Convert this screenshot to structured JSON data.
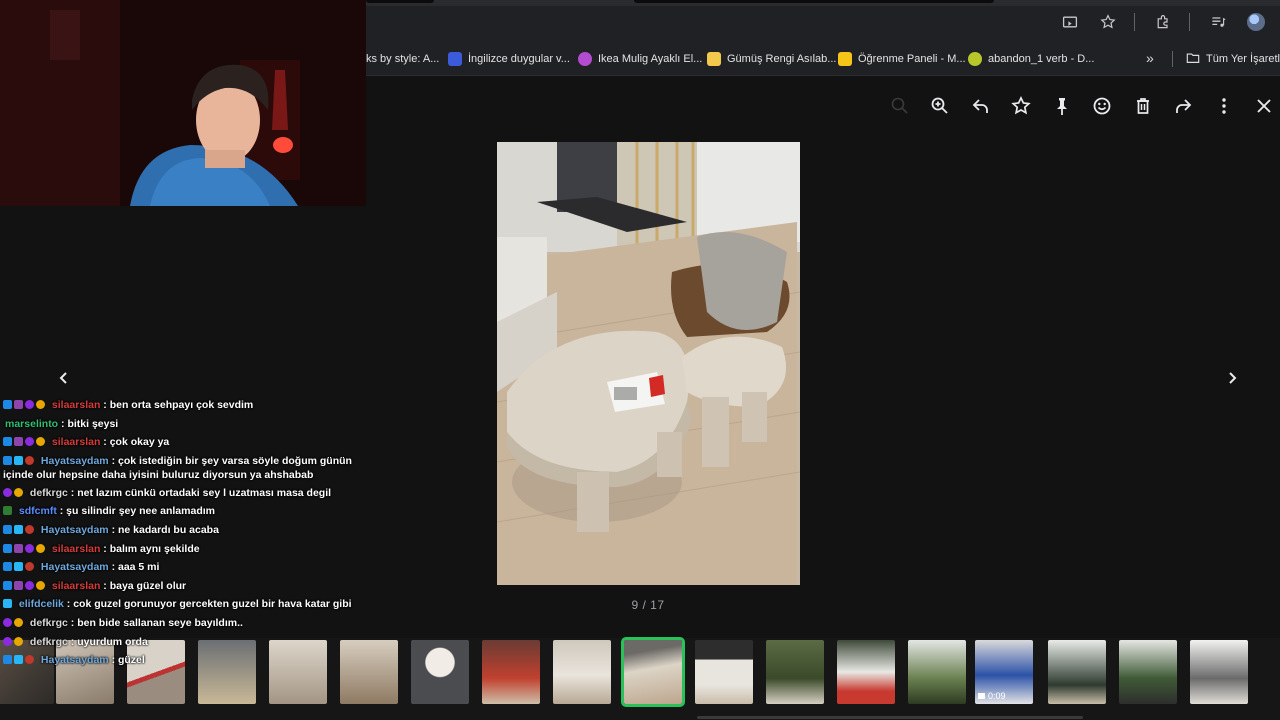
{
  "browser": {
    "toolbar_icons": [
      "cast-icon",
      "star-icon",
      "extension-icon",
      "media-icon",
      "profile-avatar"
    ],
    "bookmarks": [
      {
        "label": "ks by style: A...",
        "icon": "bookmark-favicon",
        "color": "#ffffff"
      },
      {
        "label": "İngilizce duygular v...",
        "icon": "bookmark-favicon",
        "color": "#3b5bdb"
      },
      {
        "label": "Ikea Mulig Ayaklı El...",
        "icon": "bookmark-favicon",
        "color": "#b44cd1"
      },
      {
        "label": "Gümüş Rengi Asılab...",
        "icon": "bookmark-favicon",
        "color": "#f2c94c"
      },
      {
        "label": "Öğrenme Paneli - M...",
        "icon": "bookmark-favicon",
        "color": "#f5c518"
      },
      {
        "label": "abandon_1 verb - D...",
        "icon": "bookmark-favicon",
        "color": "#b7c72a"
      }
    ],
    "bookmarks_more": "»",
    "all_bookmarks": "Tüm Yer İşaretleri"
  },
  "viewer": {
    "counter": "9 / 17",
    "tools": [
      "zoom-out-icon",
      "zoom-in-icon",
      "reply-icon",
      "star-icon",
      "pin-icon",
      "emoji-icon",
      "delete-icon",
      "forward-icon",
      "more-icon",
      "close-icon"
    ],
    "selected_index": 9,
    "video_duration": "0:09"
  },
  "chat": {
    "messages": [
      {
        "user": "silaarslan",
        "text": ": ben orta sehpayı çok sevdim",
        "color": "#d63b3b"
      },
      {
        "user": "marselinto",
        "text": ": bitki şeysi",
        "color": "#2fbf71"
      },
      {
        "user": "silaarslan",
        "text": ": çok okay ya",
        "color": "#d63b3b"
      },
      {
        "user": "Hayatsaydam",
        "text": ": çok istediğin bir şey varsa söyle doğum günün içinde olur hepsine daha iyisini buluruz diyorsun ya ahshabab",
        "color": "#6fa8dc"
      },
      {
        "user": "defkrgc",
        "text": ": net lazım cünkü ortadaki sey l uzatması masa degil",
        "color": "#d9d9d9"
      },
      {
        "user": "sdfcmft",
        "text": ": şu silindir şey nee anlamadım",
        "color": "#5b8cff"
      },
      {
        "user": "Hayatsaydam",
        "text": ": ne kadardı bu acaba",
        "color": "#6fa8dc"
      },
      {
        "user": "silaarslan",
        "text": ": balım aynı şekilde",
        "color": "#d63b3b"
      },
      {
        "user": "Hayatsaydam",
        "text": ": aaa 5 mi",
        "color": "#6fa8dc"
      },
      {
        "user": "silaarslan",
        "text": ": baya güzel olur",
        "color": "#d63b3b"
      },
      {
        "user": "elifdcelik",
        "text": ": cok guzel gorunuyor gercekten guzel bir hava katar gibi",
        "color": "#6fa8dc"
      },
      {
        "user": "defkrgc",
        "text": ": ben bide sallanan seye bayıldım..",
        "color": "#d9d9d9"
      },
      {
        "user": "defkrgc",
        "text": ": uyurdum orda",
        "color": "#d9d9d9"
      },
      {
        "user": "Hayatsaydam",
        "text": ": güzel",
        "color": "#6fa8dc"
      }
    ]
  }
}
